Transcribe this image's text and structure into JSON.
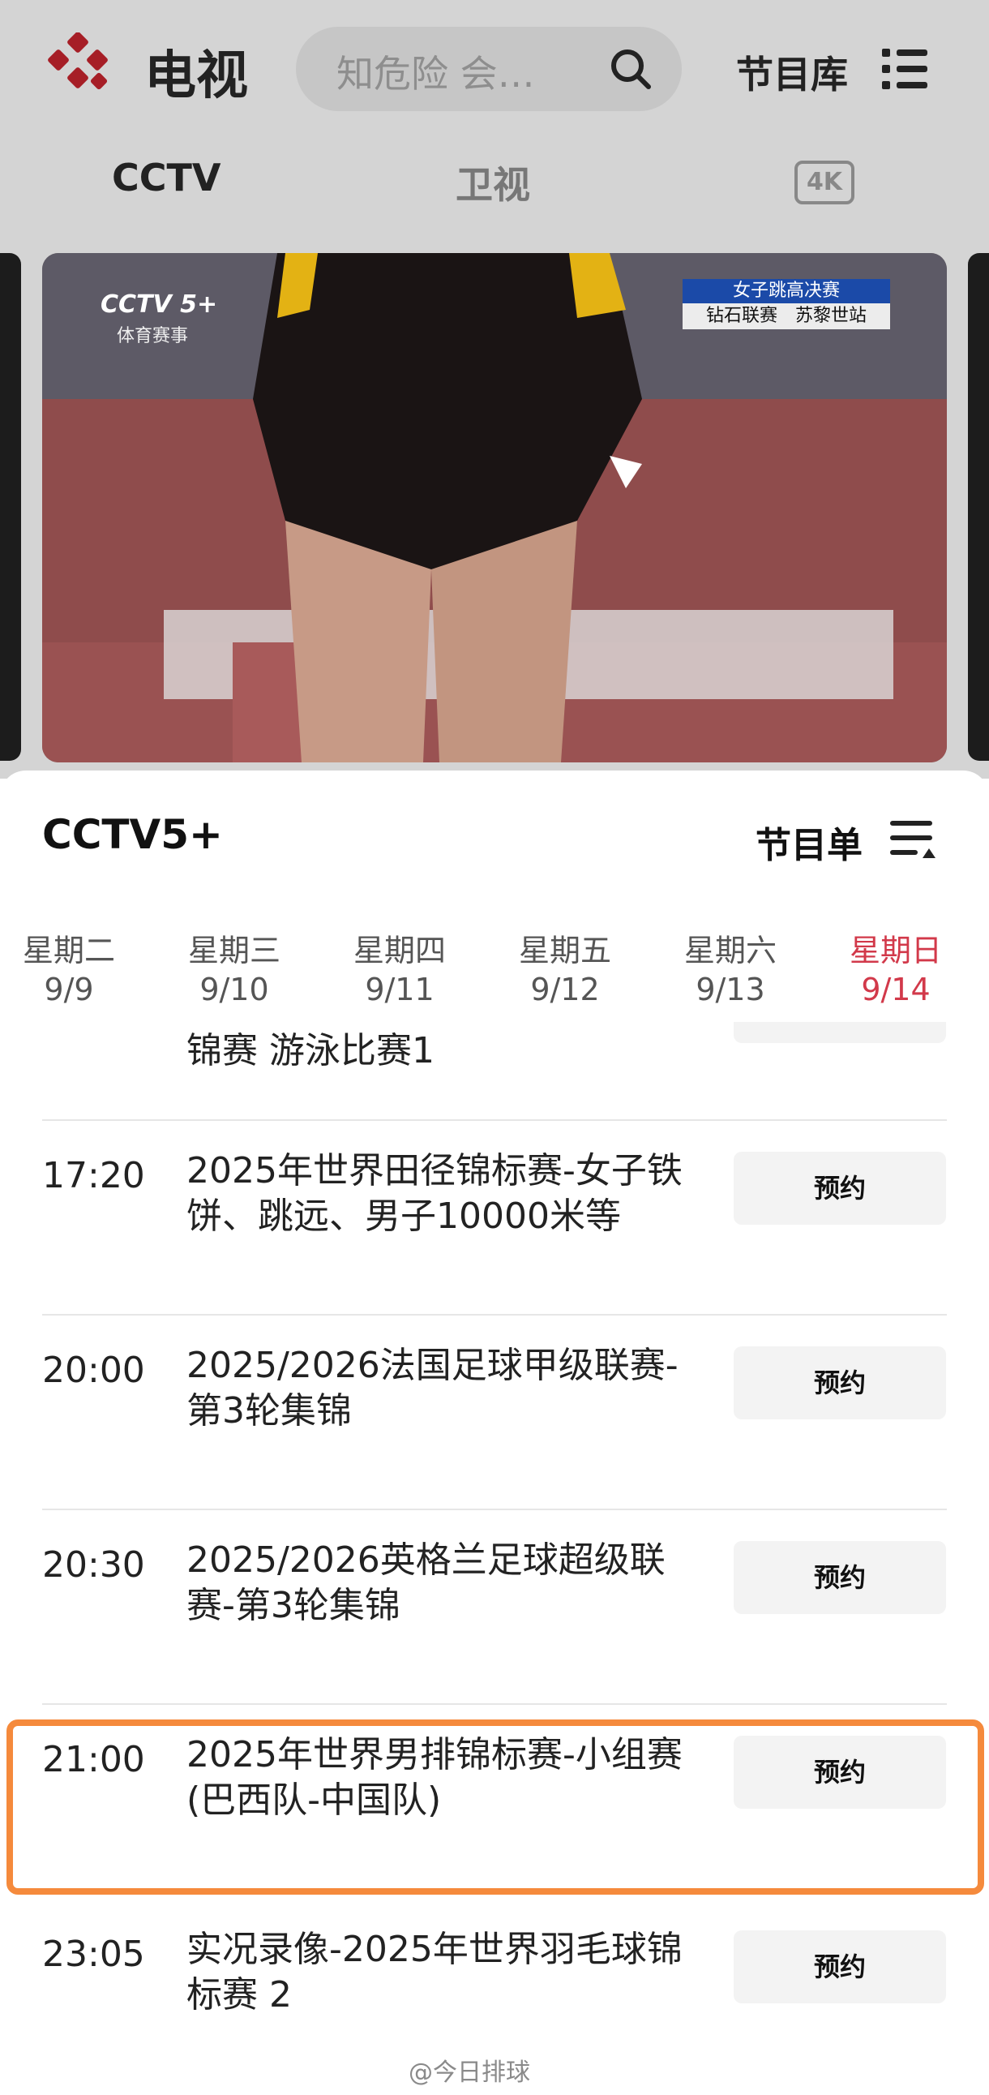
{
  "header": {
    "app_title": "电视",
    "search_placeholder": "知危险 会…",
    "library_label": "节目库"
  },
  "top_tabs": [
    {
      "label": "CCTV"
    },
    {
      "label": "卫视"
    },
    {
      "label": "4K"
    }
  ],
  "player": {
    "channel_logo": "CCTV 5+",
    "channel_sub": "体育赛事",
    "overlay_line1": "女子跳高决赛",
    "overlay_line2": "钻石联赛　苏黎世站"
  },
  "sheet": {
    "channel_name": "CCTV5+",
    "schedule_label": "节目单",
    "days": [
      {
        "weekday": "星期二",
        "date": "9/9"
      },
      {
        "weekday": "星期三",
        "date": "9/10"
      },
      {
        "weekday": "星期四",
        "date": "9/11"
      },
      {
        "weekday": "星期五",
        "date": "9/12"
      },
      {
        "weekday": "星期六",
        "date": "9/13"
      },
      {
        "weekday": "星期日",
        "date": "9/14",
        "active": true
      }
    ],
    "partial_title": "锦赛 游泳比赛1",
    "programs": [
      {
        "time": "17:20",
        "title": "2025年世界田径锦标赛-女子铁饼、跳远、男子10000米等",
        "button": "预约"
      },
      {
        "time": "20:00",
        "title": "2025/2026法国足球甲级联赛-第3轮集锦",
        "button": "预约"
      },
      {
        "time": "20:30",
        "title": "2025/2026英格兰足球超级联赛-第3轮集锦",
        "button": "预约"
      },
      {
        "time": "21:00",
        "title": "2025年世界男排锦标赛-小组赛(巴西队-中国队)",
        "button": "预约",
        "highlighted": true
      },
      {
        "time": "23:05",
        "title": "实况录像-2025年世界羽毛球锦标赛  2",
        "button": "预约"
      }
    ]
  },
  "watermark": "@今日排球",
  "colors": {
    "accent_red": "#d2394a",
    "highlight_orange": "#f58a3c",
    "logo_red": "#c81f2c"
  }
}
